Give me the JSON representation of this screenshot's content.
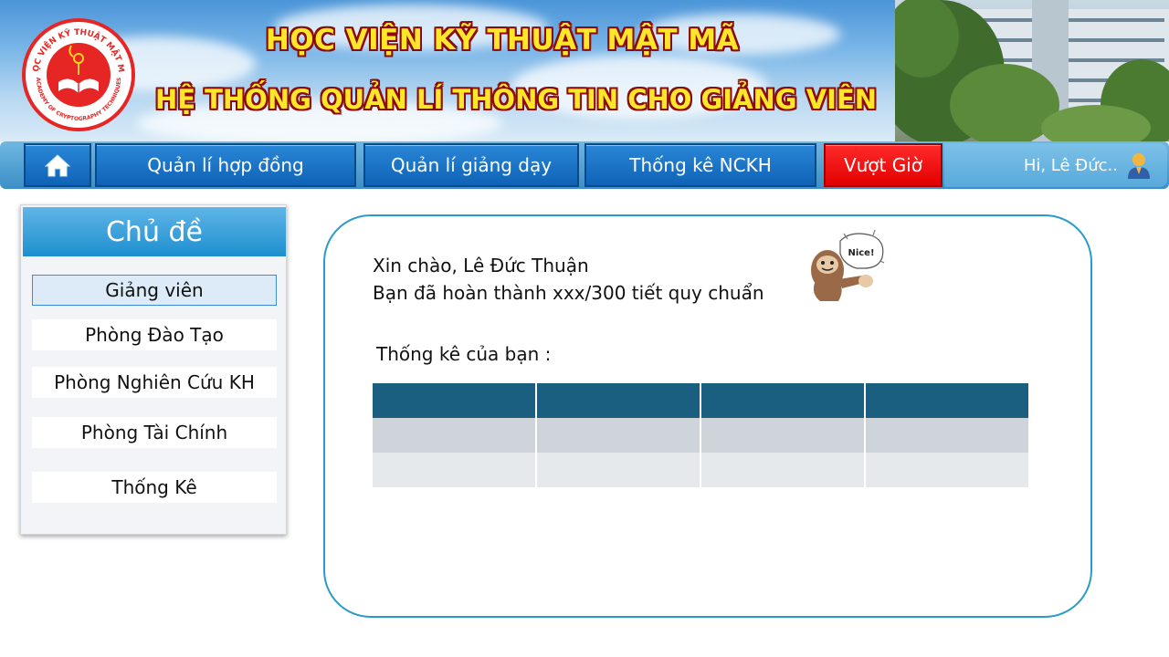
{
  "header": {
    "title": "HỌC VIỆN KỸ THUẬT MẬT MÃ",
    "subtitle": "HỆ THỐNG QUẢN LÍ THÔNG TIN CHO GIẢNG VIÊN",
    "logo_text_top": "HỌC VIỆN KỸ THUẬT MẬT MÃ",
    "logo_text_bottom": "ACADEMY OF CRYPTOGRAPHY TECHNIQUES"
  },
  "nav": {
    "home_icon": "home-icon",
    "items": [
      {
        "label": "Quản lí hợp đồng"
      },
      {
        "label": "Quản lí giảng dạy"
      },
      {
        "label": "Thống kê NCKH"
      },
      {
        "label": "Vượt Giờ"
      }
    ],
    "user_greeting": "Hi, Lê Đức..",
    "user_icon": "user-icon"
  },
  "sidebar": {
    "heading": "Chủ đề",
    "items": [
      {
        "label": "Giảng viên",
        "active": true
      },
      {
        "label": "Phòng Đào Tạo"
      },
      {
        "label": "Phòng Nghiên Cứu KH"
      },
      {
        "label": "Phòng Tài Chính"
      },
      {
        "label": "Thống Kê"
      }
    ]
  },
  "main": {
    "greeting": "Xin chào, Lê Đức Thuận",
    "progress_text": "Bạn đã hoàn thành xxx/300 tiết quy chuẩn",
    "stats_label": "Thống kê của bạn :",
    "sticker_text": "Nice!",
    "table": {
      "headers": [
        "",
        "",
        "",
        ""
      ],
      "rows": [
        [
          "",
          "",
          "",
          ""
        ],
        [
          "",
          "",
          "",
          ""
        ]
      ]
    }
  },
  "colors": {
    "nav_blue": "#0f63b6",
    "overtime_red": "#e20000",
    "card_border": "#2a9bc8",
    "table_header": "#1a5f80",
    "title_yellow": "#ffe629"
  }
}
